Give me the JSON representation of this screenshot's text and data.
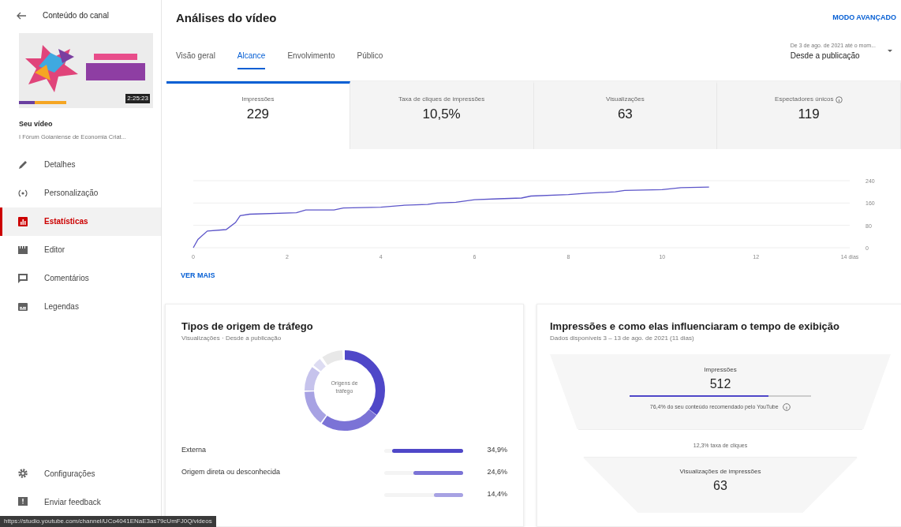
{
  "sidebar": {
    "back_label": "Conteúdo do canal",
    "video": {
      "duration": "2:25:23",
      "heading": "Seu vídeo",
      "title": "I Fórum Goianiense de Economia Criat..."
    },
    "items": [
      {
        "label": "Detalhes",
        "selected": false
      },
      {
        "label": "Personalização",
        "selected": false
      },
      {
        "label": "Estatísticas",
        "selected": true
      },
      {
        "label": "Editor",
        "selected": false
      },
      {
        "label": "Comentários",
        "selected": false
      },
      {
        "label": "Legendas",
        "selected": false
      }
    ],
    "bottom_items": [
      {
        "label": "Configurações"
      },
      {
        "label": "Enviar feedback"
      }
    ]
  },
  "header": {
    "title": "Análises do vídeo",
    "advanced_link": "MODO AVANÇADO"
  },
  "tabs": [
    {
      "label": "Visão geral",
      "selected": false
    },
    {
      "label": "Alcance",
      "selected": true
    },
    {
      "label": "Envolvimento",
      "selected": false
    },
    {
      "label": "Público",
      "selected": false
    }
  ],
  "date_range": {
    "caption": "De 3 de ago. de 2021 até o mom...",
    "value": "Desde a publicação"
  },
  "metrics": [
    {
      "label": "Impressões",
      "value": "229",
      "selected": true,
      "info": false
    },
    {
      "label": "Taxa de cliques de impressões",
      "value": "10,5%",
      "selected": false,
      "info": false
    },
    {
      "label": "Visualizações",
      "value": "63",
      "selected": false,
      "info": false
    },
    {
      "label": "Espectadores únicos",
      "value": "119",
      "selected": false,
      "info": true
    }
  ],
  "chart": {
    "chart_data": {
      "type": "line",
      "x": [
        0,
        0.1,
        0.3,
        0.7,
        0.9,
        1.0,
        1.2,
        2.2,
        2.4,
        3.0,
        3.2,
        4.0,
        4.5,
        5.0,
        5.2,
        5.6,
        6.0,
        6.5,
        7.0,
        7.2,
        8.0,
        8.4,
        9.0,
        9.2,
        10.0,
        10.4,
        11.0
      ],
      "series": [
        {
          "color": "#5c55c9",
          "values": [
            0,
            30,
            60,
            65,
            90,
            115,
            120,
            125,
            135,
            135,
            142,
            145,
            152,
            155,
            160,
            163,
            172,
            175,
            178,
            185,
            190,
            195,
            200,
            205,
            208,
            215,
            217
          ]
        }
      ],
      "xlim": [
        0,
        14
      ],
      "ylim": [
        0,
        240
      ],
      "xticks": [
        0,
        2,
        4,
        6,
        8,
        10,
        12,
        {
          "value": 14,
          "label": "14 dias"
        }
      ],
      "yticks": [
        0,
        80,
        160,
        240
      ]
    },
    "more_link": "VER MAIS"
  },
  "traffic": {
    "title": "Tipos de origem de tráfego",
    "subtitle": "Visualizações · Desde a publicação",
    "donut_label": "Origens de tráfego",
    "rows": [
      {
        "label": "Externa",
        "level": 0.9,
        "percent": "34,9%",
        "color": "#4f47c8"
      },
      {
        "label": "Origem direta ou desconhecida",
        "level": 0.63,
        "percent": "24,6%",
        "color": "#7b73d6"
      },
      {
        "percent": "14,4%",
        "level": 0.37,
        "color": "#a7a2e3"
      }
    ]
  },
  "funnel": {
    "title": "Impressões e como elas influenciaram o tempo de exibição",
    "subtitle": "Dados disponíveis 3 – 13 de ago. de 2021 (11 dias)",
    "impressions_label": "Impressões",
    "impressions_value": "512",
    "recommended": {
      "level": 0.764,
      "text": "76,4% do seu conteúdo recomendado pelo YouTube"
    },
    "ctr_text": "12,3% taxa de cliques",
    "views_label": "Visualizações de impressões",
    "views_value": "63"
  },
  "status_url": "https://studio.youtube.com/channel/UCo4041ENaE3as79cUmFJ0Q/videos"
}
